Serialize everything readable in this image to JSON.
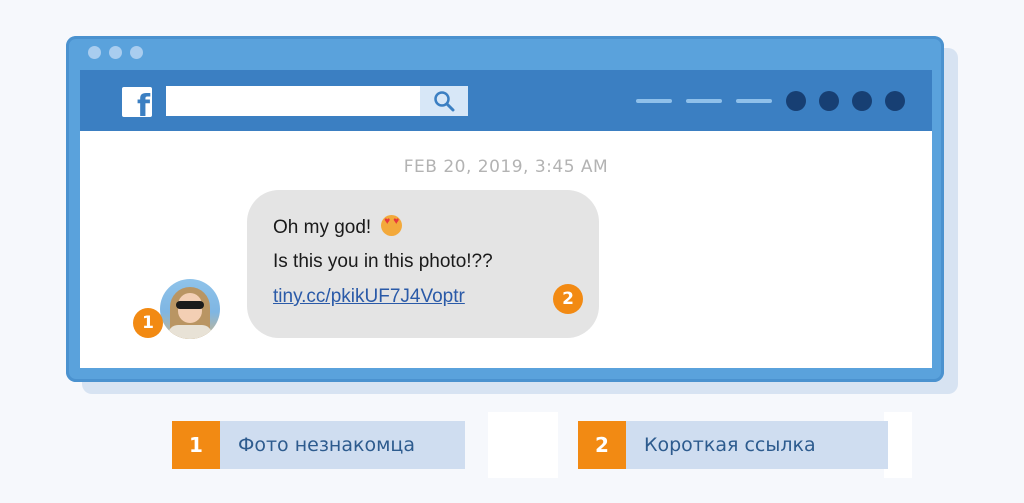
{
  "colors": {
    "accent": "#3b7fc2",
    "badge": "#f28a13",
    "link": "#2a5aa8"
  },
  "browser": {
    "dots": [
      "dot",
      "dot",
      "dot"
    ]
  },
  "toolbar": {
    "logo_letter": "f",
    "search_icon": "search-icon"
  },
  "chat": {
    "timestamp": "FEB 20, 2019, 3:45 AM",
    "avatar_badge": "1",
    "message_line1": "Oh my god!",
    "message_line2": "Is this you in this photo!??",
    "link_text": "tiny.cc/pkikUF7J4Voptr",
    "link_badge": "2",
    "emoji": "heart-eyes-emoji"
  },
  "legend": [
    {
      "number": "1",
      "label": "Фото незнакомца"
    },
    {
      "number": "2",
      "label": "Короткая ссылка"
    }
  ]
}
